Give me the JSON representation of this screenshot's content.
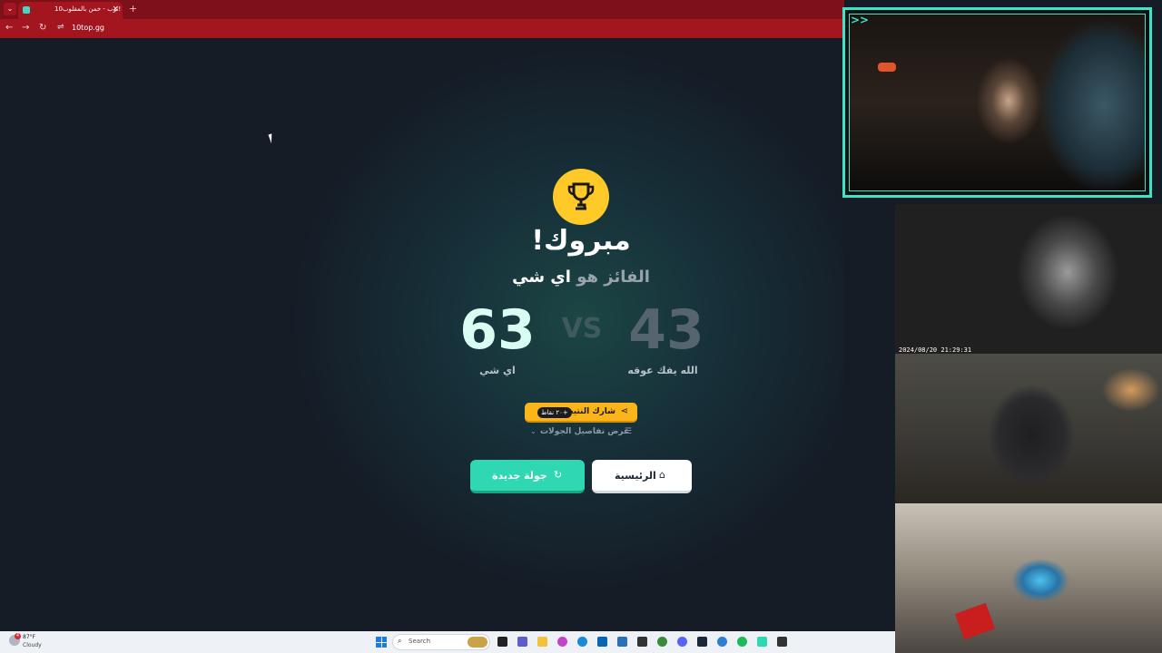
{
  "browser": {
    "tab_title": "10توب - خمن بالمقلوب!",
    "tab_close": "×",
    "new_tab": "+",
    "url": "10top.gg",
    "nav": {
      "back": "←",
      "forward": "→",
      "reload": "↻",
      "site_info": "⇌"
    }
  },
  "result": {
    "congrats": "مبروك!",
    "winner_prefix": "الفائز هو ",
    "winner_name": "اي شي",
    "vs": "VS",
    "left_score": "63",
    "left_name": "اي شي",
    "right_score": "43",
    "right_name": "الله يفك عوقه"
  },
  "actions": {
    "share_label": "شارك النتيجة",
    "share_badge": "+٢٠ نقاط",
    "details_label": "عرض تفاصيل الجولات",
    "new_round_label": "جولة جديدة",
    "home_label": "الرئيسية"
  },
  "overlay": {
    "mark": ">>",
    "timestamp": "2024/08/20 21:29:31"
  },
  "taskbar": {
    "weather_badge": "4",
    "weather_temp": "87°F",
    "weather_condition": "Cloudy",
    "search_placeholder": "Search"
  },
  "colors": {
    "accent_teal": "#2fd8b3",
    "trophy_yellow": "#ffc928",
    "share_yellow": "#fbb51b",
    "browser_red": "#a3151f"
  }
}
